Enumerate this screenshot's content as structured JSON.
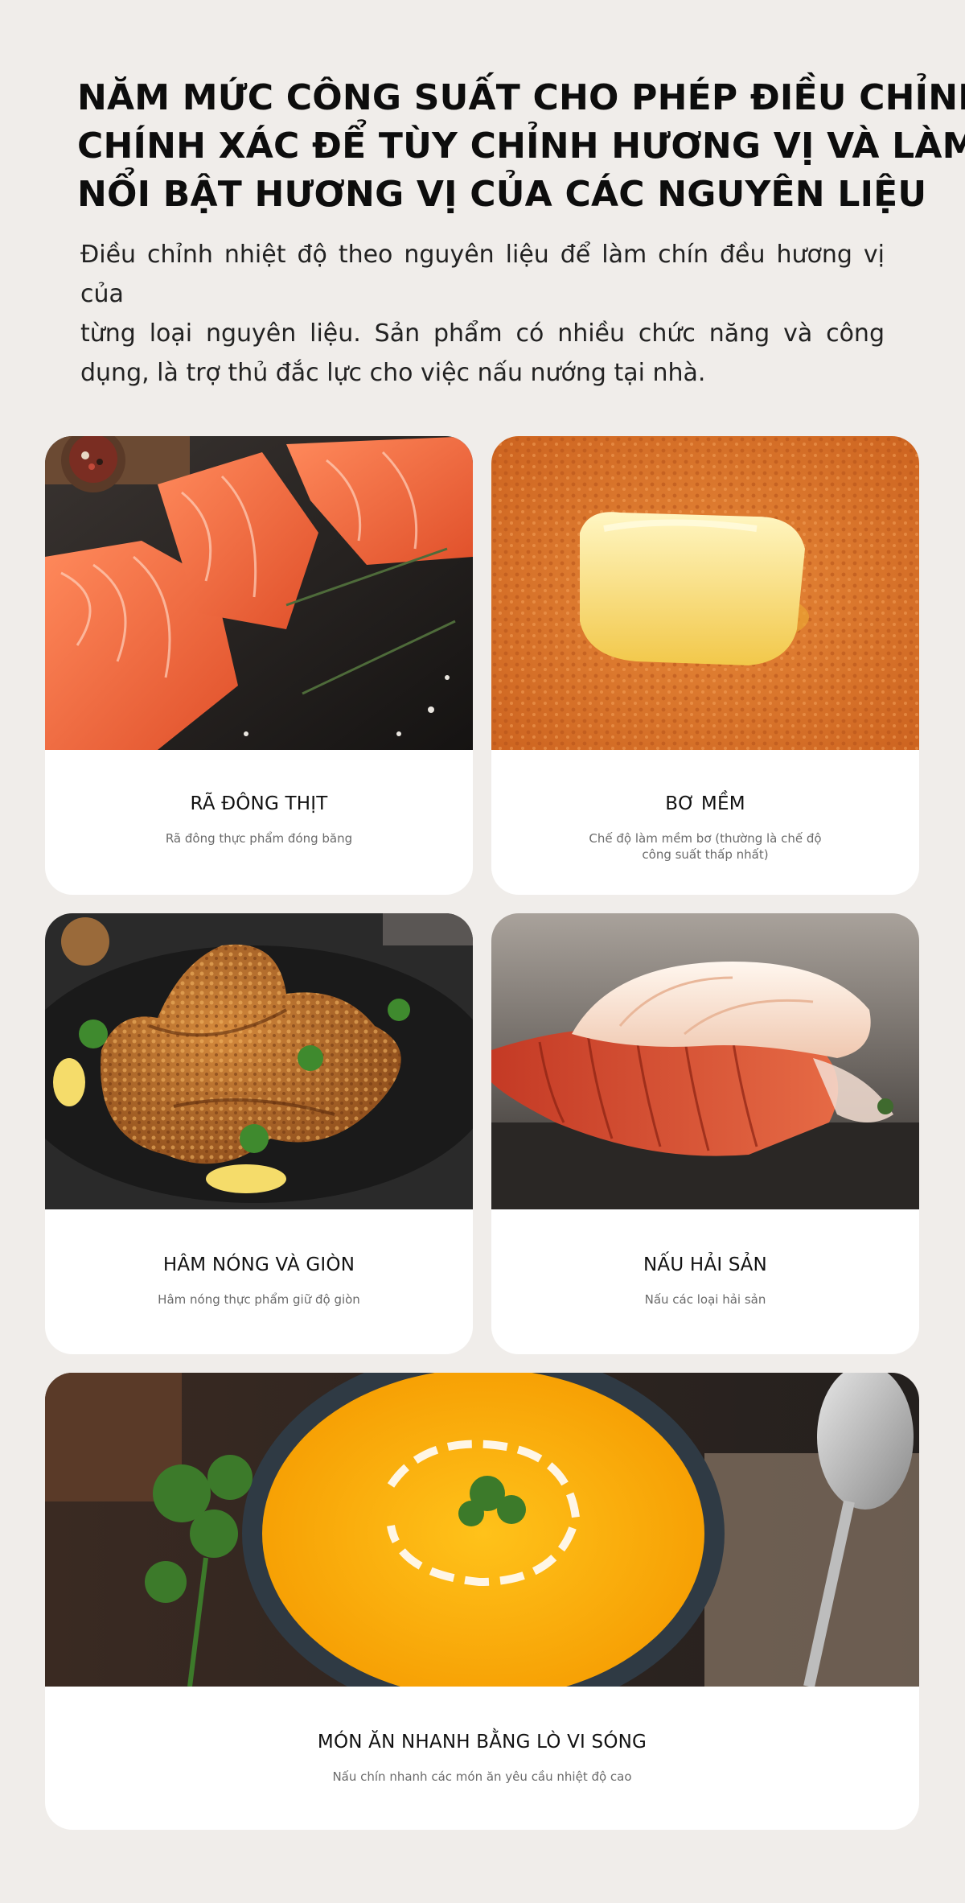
{
  "header": {
    "title_lines": [
      "NĂM MỨC CÔNG SUẤT CHO PHÉP ĐIỀU CHỈNH",
      "CHÍNH XÁC ĐỂ TÙY CHỈNH HƯƠNG VỊ VÀ LÀM",
      "NỔI BẬT HƯƠNG VỊ CỦA CÁC NGUYÊN LIỆU"
    ],
    "description_lines": [
      "Điều chỉnh nhiệt độ theo nguyên liệu để làm chín đều hương vị của",
      "từng loại nguyên liệu. Sản phẩm có nhiều chức năng và công",
      "dụng, là trợ thủ đắc lực cho việc nấu nướng tại nhà."
    ]
  },
  "cards": [
    {
      "image": "salmon-fillets-image",
      "title": "RÃ ĐÔNG THỊT",
      "subtitle_lines": [
        "Rã đông thực phẩm đóng băng"
      ]
    },
    {
      "image": "butter-on-toast-image",
      "title": "BƠ MỀM",
      "subtitle_lines": [
        "Chế độ làm mềm bơ (thường là chế độ",
        "công suất thấp nhất)"
      ]
    },
    {
      "image": "fried-chicken-image",
      "title": "HÂM NÓNG VÀ GIÒN",
      "subtitle_lines": [
        "Hâm nóng thực phẩm giữ độ giòn"
      ]
    },
    {
      "image": "lobster-tail-image",
      "title": "NẤU HẢI SẢN",
      "subtitle_lines": [
        "Nấu các loại hải sản"
      ]
    },
    {
      "image": "pumpkin-soup-image",
      "title": "MÓN ĂN NHANH BẰNG LÒ VI SÓNG",
      "subtitle_lines": [
        "Nấu chín nhanh các món ăn yêu cầu nhiệt độ cao"
      ]
    }
  ],
  "colors": {
    "page_background": "#f0edea",
    "card_background": "#ffffff",
    "title_text": "#0d0d0d",
    "subtitle_text": "#6b6b6b"
  }
}
